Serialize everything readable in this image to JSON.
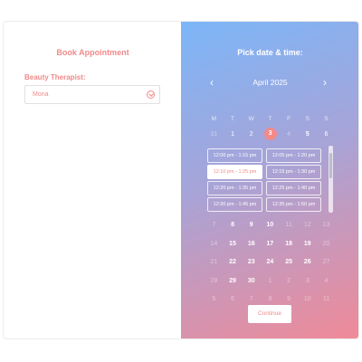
{
  "left": {
    "title": "Book Appointment",
    "therapist_label": "Beauty Therapist:",
    "therapist_value": "Mona"
  },
  "right": {
    "title": "Pick date & time:",
    "month": "April 2025",
    "weekdays": [
      "M",
      "T",
      "W",
      "T",
      "F",
      "S",
      "S"
    ],
    "week1": [
      {
        "d": "31",
        "s": "dim"
      },
      {
        "d": "1",
        "s": ""
      },
      {
        "d": "2",
        "s": ""
      },
      {
        "d": "3",
        "s": "selected"
      },
      {
        "d": "4",
        "s": "dim"
      },
      {
        "d": "5",
        "s": "bold"
      },
      {
        "d": "6",
        "s": ""
      }
    ],
    "slots": [
      "12:00 pm - 1:15 pm",
      "12:05 pm - 1:20 pm",
      "12:10 pm - 1:25 pm",
      "12:15 pm - 1:30 pm",
      "12:20 pm - 1:35 pm",
      "12:25 pm - 1:40 pm",
      "12:30 pm - 1:45 pm",
      "12:35 pm - 1:50 pm"
    ],
    "active_slot": "12:10 pm - 1:25 pm",
    "weeks": [
      [
        {
          "d": "7",
          "s": "dim"
        },
        {
          "d": "8",
          "s": "bold"
        },
        {
          "d": "9",
          "s": "bold"
        },
        {
          "d": "10",
          "s": "bold"
        },
        {
          "d": "11",
          "s": "dim"
        },
        {
          "d": "12",
          "s": "dim"
        },
        {
          "d": "13",
          "s": "dim"
        }
      ],
      [
        {
          "d": "14",
          "s": "dim"
        },
        {
          "d": "15",
          "s": "bold"
        },
        {
          "d": "16",
          "s": "bold"
        },
        {
          "d": "17",
          "s": "bold"
        },
        {
          "d": "18",
          "s": "bold"
        },
        {
          "d": "19",
          "s": "bold"
        },
        {
          "d": "20",
          "s": "dim"
        }
      ],
      [
        {
          "d": "21",
          "s": "dim"
        },
        {
          "d": "22",
          "s": "bold"
        },
        {
          "d": "23",
          "s": "bold"
        },
        {
          "d": "24",
          "s": "bold"
        },
        {
          "d": "25",
          "s": "bold"
        },
        {
          "d": "26",
          "s": "bold"
        },
        {
          "d": "27",
          "s": "dim"
        }
      ],
      [
        {
          "d": "28",
          "s": "dim"
        },
        {
          "d": "29",
          "s": "bold"
        },
        {
          "d": "30",
          "s": "bold"
        },
        {
          "d": "1",
          "s": "dim"
        },
        {
          "d": "2",
          "s": "dim"
        },
        {
          "d": "3",
          "s": "dim"
        },
        {
          "d": "4",
          "s": "dim"
        }
      ],
      [
        {
          "d": "5",
          "s": "dim"
        },
        {
          "d": "6",
          "s": "dim"
        },
        {
          "d": "7",
          "s": "dim"
        },
        {
          "d": "8",
          "s": "dim"
        },
        {
          "d": "9",
          "s": "dim"
        },
        {
          "d": "10",
          "s": "dim"
        },
        {
          "d": "11",
          "s": "dim"
        }
      ]
    ],
    "continue_label": "Continue"
  },
  "colors": {
    "accent": "#f08a8a",
    "gradient_start": "#7cb6f8",
    "gradient_end": "#f08a98"
  },
  "icons": {
    "prev": "chevron-left-icon",
    "next": "chevron-right-icon",
    "select": "chevron-down-circle-icon"
  }
}
